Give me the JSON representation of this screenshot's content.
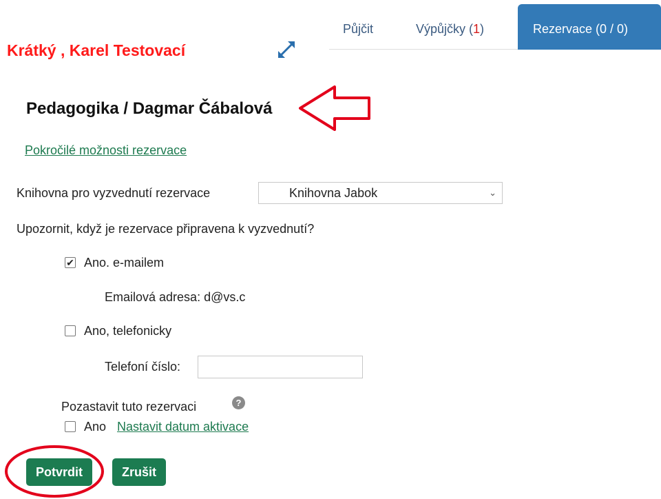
{
  "patron": {
    "name": "Krátký , Karel Testovací"
  },
  "tabs": [
    {
      "label": "Půjčit"
    },
    {
      "label_prefix": "Výpůjčky (",
      "count": "1",
      "label_suffix": ")"
    },
    {
      "label": "Rezervace (0 / 0)",
      "active": true
    }
  ],
  "item": {
    "title": "Pedagogika / Dagmar Čábalová"
  },
  "advanced_link": "Pokročilé možnosti rezervace",
  "pickup": {
    "label": "Knihovna pro vyzvednutí rezervace",
    "selected": "Knihovna Jabok"
  },
  "notify": {
    "question": "Upozornit, když je rezervace připravena k vyzvednutí?",
    "email_option": {
      "label": "Ano. e-mailem",
      "checked": true
    },
    "email_address_line": "Emailová adresa: d@vs.c",
    "phone_option": {
      "label": "Ano, telefonicky",
      "checked": false
    },
    "phone_label": "Telefoní číslo:",
    "phone_value": ""
  },
  "suspend": {
    "label": "Pozastavit tuto rezervaci",
    "help_glyph": "?",
    "checkbox_label": "Ano",
    "checked": false,
    "activation_link": "Nastavit datum aktivace"
  },
  "buttons": {
    "confirm": "Potvrdit",
    "cancel": "Zrušit"
  },
  "colors": {
    "accent_green": "#1c7c51",
    "tab_active_bg": "#337ab7",
    "patron_red": "#ff1a1a",
    "annotation_red": "#e3001b"
  }
}
